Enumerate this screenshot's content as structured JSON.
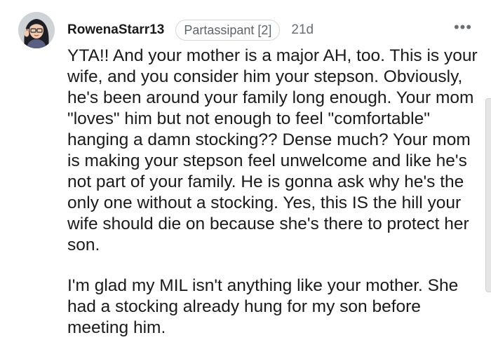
{
  "comment": {
    "username": "RowenaStarr13",
    "flair": "Partassipant [2]",
    "time": "21d",
    "more_label": "•••",
    "paragraphs": [
      "YTA!! And your mother is a major AH, too. This is your wife, and you consider him your stepson. Obviously, he's been around your family long enough. Your mom \"loves\" him but not enough to feel \"comfortable\" hanging a damn stocking?? Dense much? Your mom is making your stepson feel unwelcome and like he's not part of your family. He is gonna ask why he's the only one without a stocking. Yes, this IS the hill your wife should die on because she's there to protect her son.",
      "I'm glad my MIL isn't anything like your mother. She had a stocking already hung for my son before meeting him."
    ]
  },
  "icons": {
    "avatar": "user-avatar",
    "more": "more-options-icon"
  },
  "colors": {
    "text": "#1a1a1b",
    "meta": "#6b6e72",
    "flair_border": "#d3d6da",
    "background": "#ffffff"
  }
}
